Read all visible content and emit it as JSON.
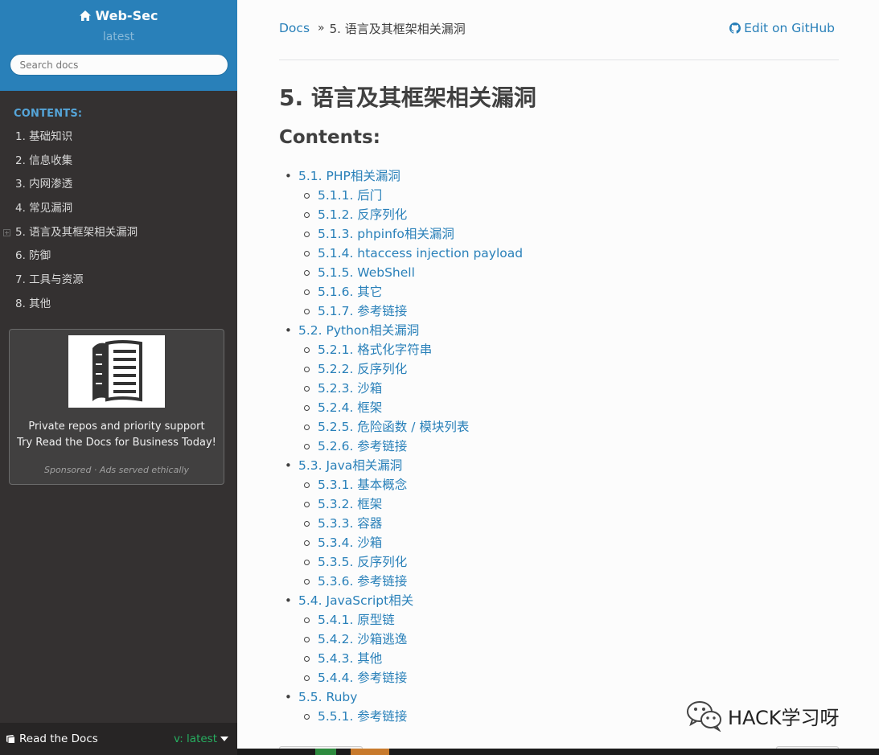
{
  "sidebar": {
    "project_name": "Web-Sec",
    "version": "latest",
    "search_placeholder": "Search docs",
    "caption": "CONTENTS:",
    "items": [
      {
        "label": "1. 基础知识"
      },
      {
        "label": "2. 信息收集"
      },
      {
        "label": "3. 内网渗透"
      },
      {
        "label": "4. 常见漏洞"
      },
      {
        "label": "5. 语言及其框架相关漏洞",
        "current": true
      },
      {
        "label": "6. 防御"
      },
      {
        "label": "7. 工具与资源"
      },
      {
        "label": "8. 其他"
      }
    ],
    "ad": {
      "line1": "Private repos and priority support",
      "line2": "Try Read the Docs for Business Today!",
      "sponsor": "Sponsored · Ads served ethically"
    },
    "rtd": {
      "label": "Read the Docs",
      "version": "v: latest"
    }
  },
  "breadcrumbs": {
    "root": "Docs",
    "separator": "»",
    "current": "5. 语言及其框架相关漏洞",
    "edit_link": "Edit on GitHub"
  },
  "page": {
    "title": "5. 语言及其框架相关漏洞",
    "contents_heading": "Contents:",
    "toc": [
      {
        "label": "5.1. PHP相关漏洞",
        "children": [
          "5.1.1. 后门",
          "5.1.2. 反序列化",
          "5.1.3. phpinfo相关漏洞",
          "5.1.4. htaccess injection payload",
          "5.1.5. WebShell",
          "5.1.6. 其它",
          "5.1.7. 参考链接"
        ]
      },
      {
        "label": "5.2. Python相关漏洞",
        "children": [
          "5.2.1. 格式化字符串",
          "5.2.2. 反序列化",
          "5.2.3. 沙箱",
          "5.2.4. 框架",
          "5.2.5. 危险函数 / 模块列表",
          "5.2.6. 参考链接"
        ]
      },
      {
        "label": "5.3. Java相关漏洞",
        "children": [
          "5.3.1. 基本概念",
          "5.3.2. 框架",
          "5.3.3. 容器",
          "5.3.4. 沙箱",
          "5.3.5. 反序列化",
          "5.3.6. 参考链接"
        ]
      },
      {
        "label": "5.4. JavaScript相关",
        "children": [
          "5.4.1. 原型链",
          "5.4.2. 沙箱逃逸",
          "5.4.3. 其他",
          "5.4.4. 参考链接"
        ]
      },
      {
        "label": "5.5. Ruby",
        "children": [
          "5.5.1. 参考链接"
        ]
      }
    ]
  },
  "watermark": "HACK学习呀",
  "colors": {
    "sidebar_top": "#2980b9",
    "sidebar_bg": "#343131",
    "link": "#2980b9",
    "caption": "#55a5d9",
    "rtd_version": "#27ae60"
  }
}
